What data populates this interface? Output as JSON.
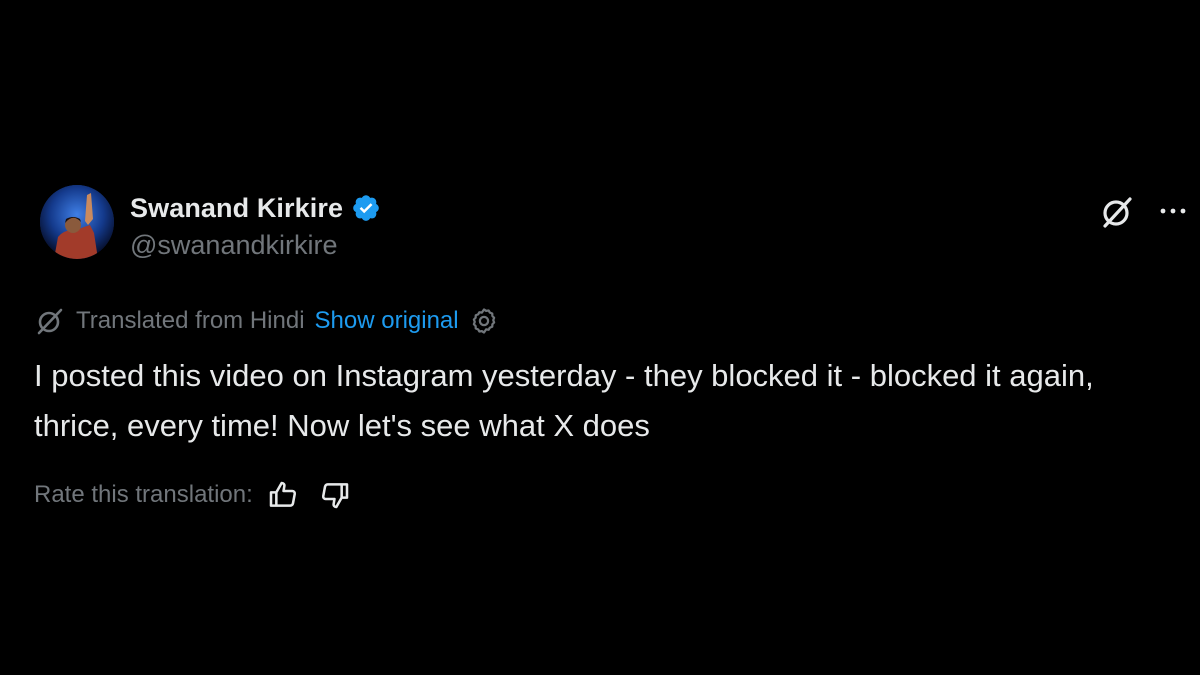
{
  "author": {
    "name": "Swanand Kirkire",
    "handle": "@swanandkirkire",
    "verified": true
  },
  "header_icons": {
    "grok": "grok-icon",
    "more": "more-options-icon"
  },
  "translation": {
    "label": "Translated from Hindi",
    "show_original": "Show original",
    "icon": "grok-icon",
    "settings_icon": "gear-icon"
  },
  "tweet": {
    "text": "I posted this video on Instagram yesterday - they blocked it - blocked it again, thrice, every time! Now let's see what X does"
  },
  "rating": {
    "label": "Rate this translation:",
    "thumbs_up_icon": "thumbs-up-icon",
    "thumbs_down_icon": "thumbs-down-icon"
  },
  "colors": {
    "background": "#000000",
    "text_primary": "#e7e9ea",
    "text_secondary": "#71767b",
    "link": "#1d9bf0",
    "verified": "#1d9bf0"
  }
}
